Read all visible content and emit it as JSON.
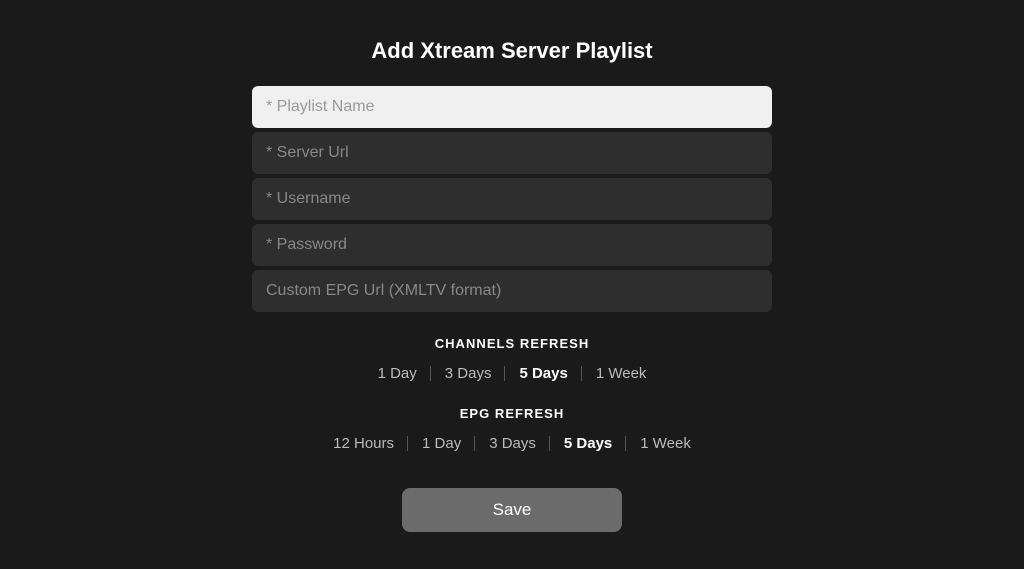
{
  "page": {
    "title": "Add Xtream Server Playlist"
  },
  "form": {
    "playlist_name_placeholder": "* Playlist Name",
    "server_url_placeholder": "* Server Url",
    "username_placeholder": "* Username",
    "password_placeholder": "* Password",
    "epg_url_placeholder": "Custom EPG Url (XMLTV format)"
  },
  "channels_refresh": {
    "label": "CHANNELS REFRESH",
    "options": [
      {
        "id": "1day",
        "label": "1 Day",
        "selected": false
      },
      {
        "id": "3days",
        "label": "3 Days",
        "selected": false
      },
      {
        "id": "5days",
        "label": "5 Days",
        "selected": true
      },
      {
        "id": "1week",
        "label": "1 Week",
        "selected": false
      }
    ]
  },
  "epg_refresh": {
    "label": "EPG REFRESH",
    "options": [
      {
        "id": "12hours",
        "label": "12 Hours",
        "selected": false
      },
      {
        "id": "1day",
        "label": "1 Day",
        "selected": false
      },
      {
        "id": "3days",
        "label": "3 Days",
        "selected": false
      },
      {
        "id": "5days",
        "label": "5 Days",
        "selected": true
      },
      {
        "id": "1week",
        "label": "1 Week",
        "selected": false
      }
    ]
  },
  "save_button": {
    "label": "Save"
  }
}
